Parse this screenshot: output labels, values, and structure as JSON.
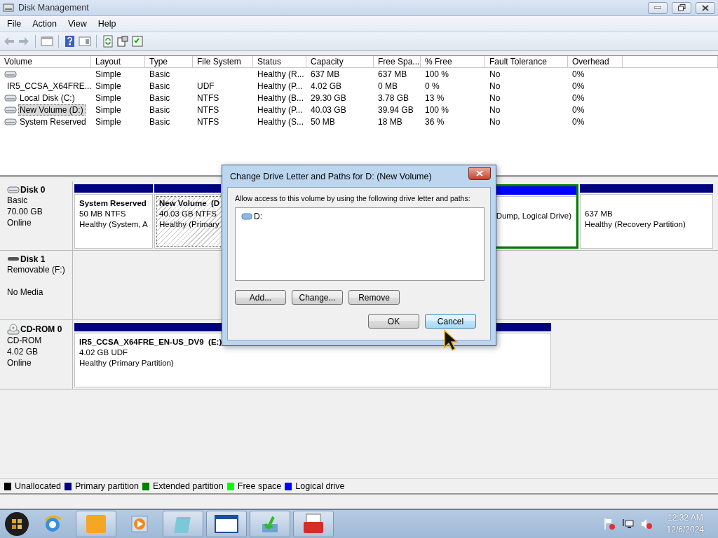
{
  "window": {
    "title": "Disk Management"
  },
  "menu": [
    "File",
    "Action",
    "View",
    "Help"
  ],
  "toolbar": {
    "back_disabled": true,
    "forward_disabled": true
  },
  "volume_table": {
    "columns": [
      "Volume",
      "Layout",
      "Type",
      "File System",
      "Status",
      "Capacity",
      "Free Spa...",
      "% Free",
      "Fault Tolerance",
      "Overhead"
    ],
    "rows": [
      {
        "kind": "disk",
        "selected": false,
        "layout": "Simple",
        "type": "Basic",
        "status": "Healthy (R...",
        "capacity": "637 MB",
        "free_space": "637 MB",
        "percent_free": "100 %",
        "fault_tolerance": "No",
        "overhead": "0%"
      },
      {
        "kind": "cdrom",
        "selected": false,
        "volume": "IR5_CCSA_X64FRE...",
        "layout": "Simple",
        "type": "Basic",
        "file_system": "UDF",
        "status": "Healthy (P...",
        "capacity": "4.02 GB",
        "free_space": "0 MB",
        "percent_free": "0 %",
        "fault_tolerance": "No",
        "overhead": "0%"
      },
      {
        "kind": "disk",
        "selected": false,
        "volume": "Local Disk (C:)",
        "layout": "Simple",
        "type": "Basic",
        "file_system": "NTFS",
        "status": "Healthy (B...",
        "capacity": "29.30 GB",
        "free_space": "3.78 GB",
        "percent_free": "13 %",
        "fault_tolerance": "No",
        "overhead": "0%"
      },
      {
        "kind": "disk",
        "selected": true,
        "volume": "New Volume (D:)",
        "layout": "Simple",
        "type": "Basic",
        "file_system": "NTFS",
        "status": "Healthy (P...",
        "capacity": "40.03 GB",
        "free_space": "39.94 GB",
        "percent_free": "100 %",
        "fault_tolerance": "No",
        "overhead": "0%"
      },
      {
        "kind": "disk",
        "selected": false,
        "volume": "System Reserved",
        "layout": "Simple",
        "type": "Basic",
        "file_system": "NTFS",
        "status": "Healthy (S...",
        "capacity": "50 MB",
        "free_space": "18 MB",
        "percent_free": "36 %",
        "fault_tolerance": "No",
        "overhead": "0%"
      }
    ]
  },
  "disks": [
    {
      "kind": "disk",
      "name": "Disk 0",
      "type": "Basic",
      "size": "70.00 GB",
      "status": "Online",
      "partitions": [
        {
          "kind": "primary",
          "selected": false,
          "name": "System Reserved",
          "size": "50 MB NTFS",
          "health": "Healthy (System, A"
        },
        {
          "kind": "primary",
          "selected": true,
          "name": "New Volume  (D",
          "size": "40.03 GB NTFS",
          "health": "Healthy (Primary"
        },
        {
          "kind": "logical",
          "selected": false,
          "health": "Dump, Logical Drive)"
        },
        {
          "kind": "primary",
          "selected": false,
          "size": "637 MB",
          "health": "Healthy (Recovery Partition)"
        }
      ]
    },
    {
      "kind": "removable",
      "name": "Disk 1",
      "type": "Removable (F:)",
      "status": "No Media"
    },
    {
      "kind": "cdrom",
      "name": "CD-ROM 0",
      "type": "CD-ROM",
      "size": "4.02 GB",
      "status": "Online",
      "partitions": [
        {
          "kind": "primary",
          "selected": false,
          "name": "IR5_CCSA_X64FRE_EN-US_DV9  (E:)",
          "size": "4.02 GB UDF",
          "health": "Healthy (Primary Partition)"
        }
      ]
    }
  ],
  "legend": [
    {
      "label": "Unallocated",
      "color": "#000000"
    },
    {
      "label": "Primary partition",
      "color": "#000080"
    },
    {
      "label": "Extended partition",
      "color": "#008000"
    },
    {
      "label": "Free space",
      "color": "#00ff00"
    },
    {
      "label": "Logical drive",
      "color": "#0000ff"
    }
  ],
  "dialog": {
    "title": "Change Drive Letter and Paths for D: (New Volume)",
    "prompt": "Allow access to this volume by using the following drive letter and paths:",
    "paths": [
      {
        "label": "D:",
        "selected": false
      }
    ],
    "action_buttons": [
      "Add...",
      "Change...",
      "Remove"
    ],
    "confirm_buttons": [
      {
        "label": "OK",
        "hovered": false
      },
      {
        "label": "Cancel",
        "hovered": true
      }
    ]
  },
  "taskbar": {
    "apps": [
      {
        "kind": "browser",
        "running": false
      },
      {
        "kind": "folder",
        "running": true
      },
      {
        "kind": "media",
        "running": false
      },
      {
        "kind": "notepad",
        "running": true
      },
      {
        "kind": "window",
        "running": true
      },
      {
        "kind": "install",
        "running": true
      },
      {
        "kind": "toolbox",
        "running": true
      }
    ],
    "time": "12:32 AM",
    "date": "12/6/2024"
  }
}
